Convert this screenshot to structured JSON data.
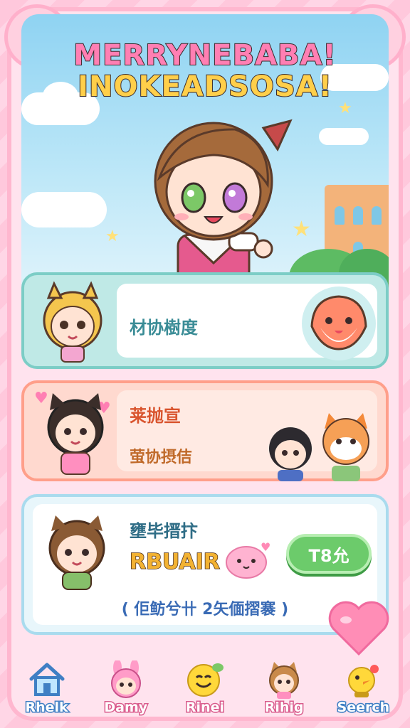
{
  "header": {
    "title_line1": "MERRYNEBABA!",
    "title_line2": "INOKEADSOSA!"
  },
  "cards": [
    {
      "label": "材协樹度"
    },
    {
      "label_top": "莱抛宣",
      "label_bottom": "萤协摂佶"
    },
    {
      "label": "壅毕搢抃",
      "rbuair": "RBUAIR",
      "button_label": "T8允",
      "footer_note": "( 佢鲂兮卄 2矢偭摺褰 )"
    }
  ],
  "nav": {
    "items": [
      {
        "label": "Rhelk",
        "icon": "house-icon"
      },
      {
        "label": "Damy",
        "icon": "bunny-girl-icon"
      },
      {
        "label": "Rinei",
        "icon": "smiley-emoji-icon"
      },
      {
        "label": "Rihig",
        "icon": "cat-girl-icon"
      },
      {
        "label": "Seerch",
        "icon": "bird-icon"
      }
    ]
  },
  "colors": {
    "pink_bg": "#ffd6e6",
    "teal_card": "#bfe9e6",
    "coral_card": "#ffd9cf",
    "sky": "#8fd3f2",
    "button_green": "#6ccb6b"
  }
}
